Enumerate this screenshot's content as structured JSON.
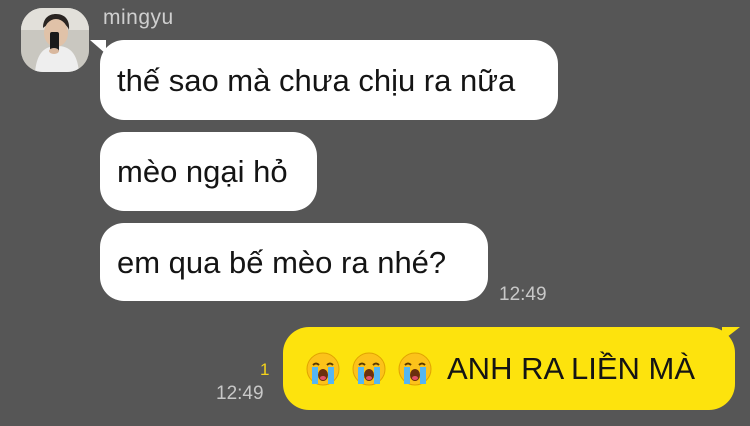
{
  "contact": {
    "name": "mingyu"
  },
  "incoming_messages": [
    "thế sao mà chưa chịu ra nữa",
    "mèo ngại hỏ",
    "em qua bế mèo ra nhé?"
  ],
  "incoming_time": "12:49",
  "outgoing_message": {
    "emojis": [
      "loudly-crying-face",
      "loudly-crying-face",
      "loudly-crying-face"
    ],
    "text": "ANH RA LIỀN MÀ",
    "time": "12:49",
    "unread_count": "1"
  },
  "colors": {
    "background": "#565656",
    "incoming_bubble": "#ffffff",
    "outgoing_bubble": "#fde30d",
    "unread_count": "#f5d31a"
  }
}
